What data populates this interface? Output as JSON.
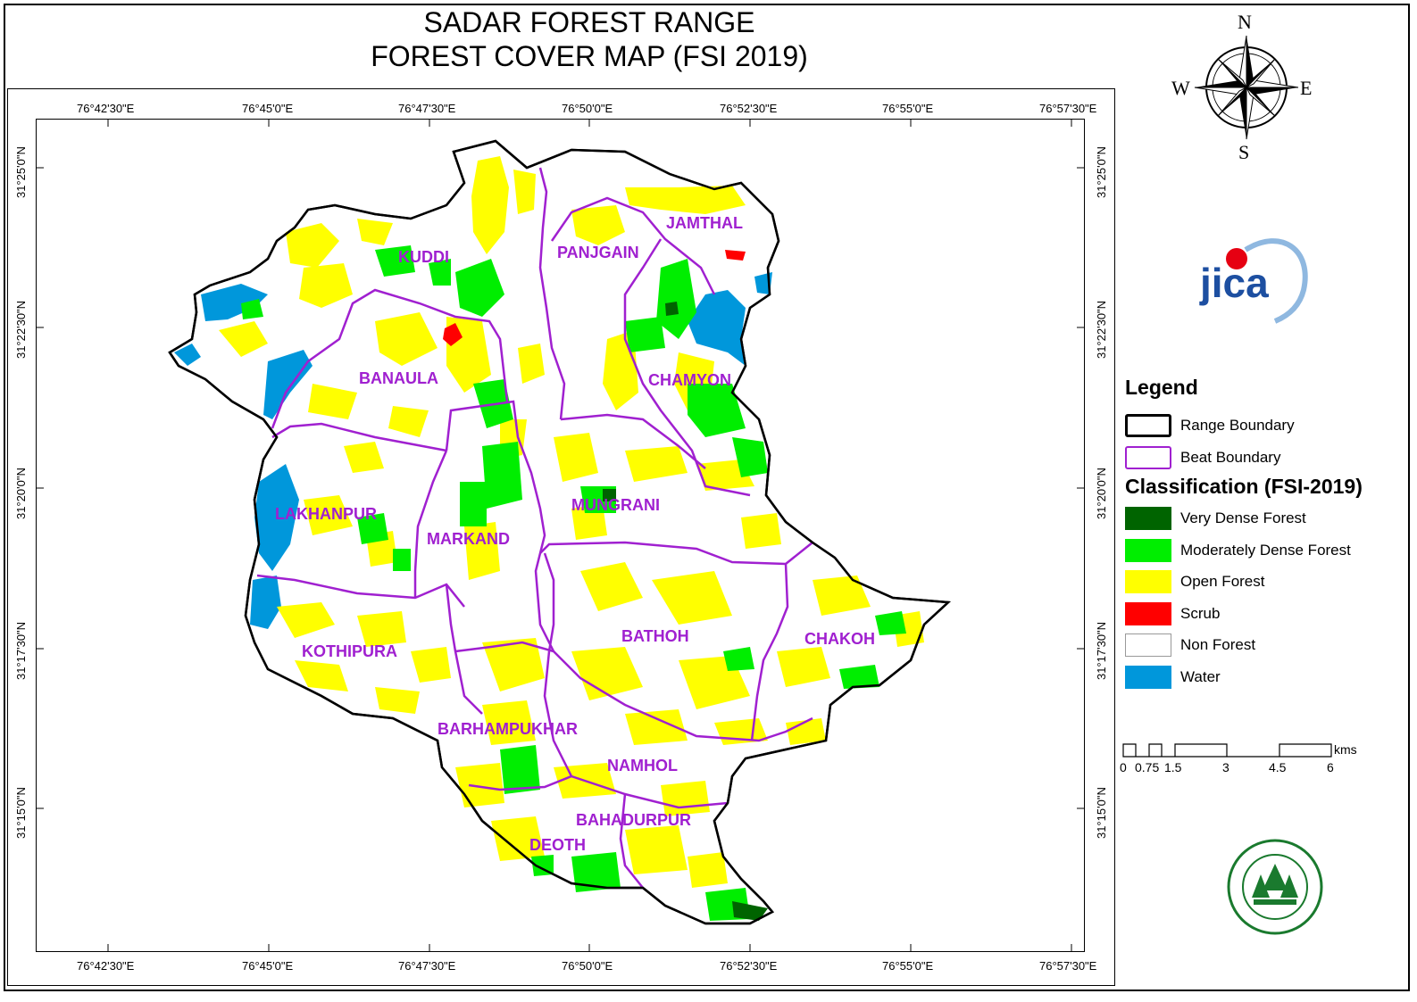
{
  "title": {
    "line1": "SADAR FOREST RANGE",
    "line2": "FOREST COVER MAP (FSI 2019)"
  },
  "graticule": {
    "lon_labels": [
      "76°42'30\"E",
      "76°45'0\"E",
      "76°47'30\"E",
      "76°50'0\"E",
      "76°52'30\"E",
      "76°55'0\"E",
      "76°57'30\"E"
    ],
    "lat_labels": [
      "31°25'0\"N",
      "31°22'30\"N",
      "31°20'0\"N",
      "31°17'30\"N",
      "31°15'0\"N"
    ]
  },
  "compass": {
    "north": "N",
    "south": "S",
    "east": "E",
    "west": "W"
  },
  "beats": [
    {
      "name": "KUDDI"
    },
    {
      "name": "PANJGAIN"
    },
    {
      "name": "JAMTHAL"
    },
    {
      "name": "BANAULA"
    },
    {
      "name": "CHAMYON"
    },
    {
      "name": "LAKHANPUR"
    },
    {
      "name": "MARKAND"
    },
    {
      "name": "MUNGRANI"
    },
    {
      "name": "BATHOH"
    },
    {
      "name": "CHAKOH"
    },
    {
      "name": "KOTHIPURA"
    },
    {
      "name": "BARHAMPUKHAR"
    },
    {
      "name": "NAMHOL"
    },
    {
      "name": "BAHADURPUR"
    },
    {
      "name": "DEOTH"
    }
  ],
  "logo": {
    "jica_text": "jica"
  },
  "legend": {
    "title": "Legend",
    "boundary_items": [
      {
        "label": "Range Boundary",
        "color": "#000000"
      },
      {
        "label": "Beat Boundary",
        "color": "#a020d0"
      }
    ],
    "classification_title": "Classification (FSI-2019)",
    "class_items": [
      {
        "label": "Very Dense Forest",
        "color": "#006400"
      },
      {
        "label": "Moderately Dense Forest",
        "color": "#00ff00"
      },
      {
        "label": "Open Forest",
        "color": "#ffff00"
      },
      {
        "label": "Scrub",
        "color": "#ff0000"
      },
      {
        "label": "Non Forest",
        "color": "#ffffff"
      },
      {
        "label": "Water",
        "color": "#0097db"
      }
    ]
  },
  "scale_bar": {
    "unit": "kms",
    "ticks": [
      "0",
      "0.75",
      "1.5",
      "3",
      "4.5",
      "6"
    ]
  }
}
